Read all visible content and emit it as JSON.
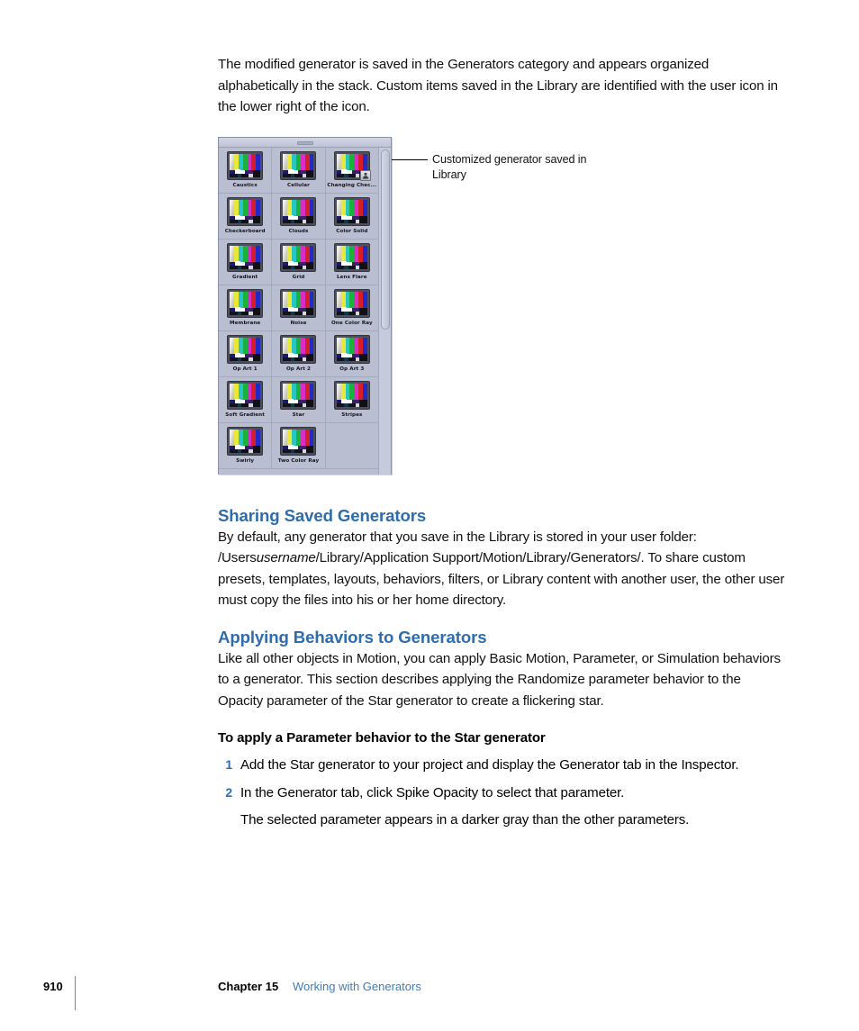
{
  "document": {
    "intro_paragraph": "The modified generator is saved in the Generators category and appears organized alphabetically in the stack. Custom items saved in the Library are identified with the user icon in the lower right of the icon.",
    "sections": [
      {
        "heading": "Sharing Saved Generators",
        "paragraph_before_path": "By default, any generator that you save in the Library is stored in your user folder: /Users",
        "path_italic": "username",
        "paragraph_after_path": "/Library/Application Support/Motion/Library/Generators/. To share custom presets, templates, layouts, behaviors, filters, or Library content with another user, the other user must copy the files into his or her home directory."
      },
      {
        "heading": "Applying Behaviors to Generators",
        "paragraph": "Like all other objects in Motion, you can apply Basic Motion, Parameter, or Simulation behaviors to a generator. This section describes applying the Randomize parameter behavior to the Opacity parameter of the Star generator to create a flickering star."
      }
    ],
    "procedure": {
      "title": "To apply a Parameter behavior to the Star generator",
      "steps": [
        {
          "number": "1",
          "text": "Add the Star generator to your project and display the Generator tab in the Inspector."
        },
        {
          "number": "2",
          "text": "In the Generator tab, click Spike Opacity to select that parameter."
        }
      ],
      "follow_up": "The selected parameter appears in a darker gray than the other parameters."
    }
  },
  "figure": {
    "callout": "Customized generator saved in Library",
    "library_panel": {
      "items": [
        {
          "label": "Caustics",
          "badge": false
        },
        {
          "label": "Cellular",
          "badge": false
        },
        {
          "label": "Changing Chec...",
          "badge": true
        },
        {
          "label": "Checkerboard",
          "badge": false
        },
        {
          "label": "Clouds",
          "badge": false
        },
        {
          "label": "Color Solid",
          "badge": false
        },
        {
          "label": "Gradient",
          "badge": false
        },
        {
          "label": "Grid",
          "badge": false
        },
        {
          "label": "Lens Flare",
          "badge": false
        },
        {
          "label": "Membrane",
          "badge": false
        },
        {
          "label": "Noise",
          "badge": false
        },
        {
          "label": "One Color Ray",
          "badge": false
        },
        {
          "label": "Op Art 1",
          "badge": false
        },
        {
          "label": "Op Art 2",
          "badge": false
        },
        {
          "label": "Op Art 3",
          "badge": false
        },
        {
          "label": "Soft Gradient",
          "badge": false
        },
        {
          "label": "Star",
          "badge": false
        },
        {
          "label": "Stripes",
          "badge": false
        },
        {
          "label": "Swirly",
          "badge": false
        },
        {
          "label": "Two Color Ray",
          "badge": false
        },
        {
          "label": "",
          "badge": false
        }
      ]
    }
  },
  "footer": {
    "page_number": "910",
    "chapter": "Chapter 15",
    "chapter_title": "Working with Generators"
  },
  "colors": {
    "heading_blue": "#2d6cae",
    "link_blue": "#3f7cbb",
    "panel_bg": "#b9bed1"
  }
}
